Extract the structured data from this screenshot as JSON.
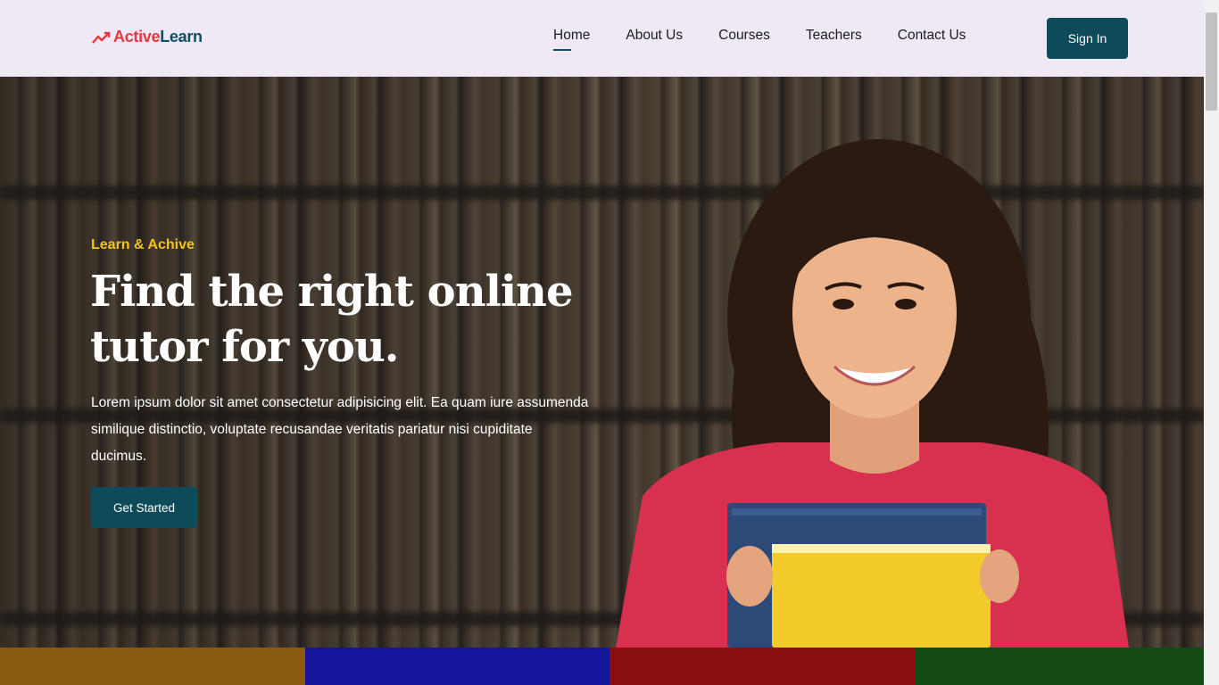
{
  "header": {
    "logo_part1": "Active",
    "logo_part2": "Learn",
    "logo_icon": "trending-up-icon",
    "nav": [
      {
        "label": "Home",
        "active": true
      },
      {
        "label": "About Us",
        "active": false
      },
      {
        "label": "Courses",
        "active": false
      },
      {
        "label": "Teachers",
        "active": false
      },
      {
        "label": "Contact Us",
        "active": false
      }
    ],
    "signin_label": "Sign In"
  },
  "hero": {
    "eyebrow": "Learn & Achive",
    "headline_line1": "Find the right online",
    "headline_line2": "tutor for you.",
    "description": "Lorem ipsum dolor sit amet consectetur adipisicing elit. Ea quam iure assumenda similique distinctio, voluptate recusandae veritatis pariatur nisi cupiditate ducimus.",
    "cta_label": "Get Started"
  },
  "colors": {
    "brand_primary": "#0e4b5a",
    "brand_accent": "#e5383f",
    "eyebrow": "#f4c21a",
    "header_bg": "#efe8f5"
  },
  "tiles": [
    {
      "color": "#8a5a10"
    },
    {
      "color": "#14159a"
    },
    {
      "color": "#8a1010"
    },
    {
      "color": "#134a16"
    }
  ]
}
